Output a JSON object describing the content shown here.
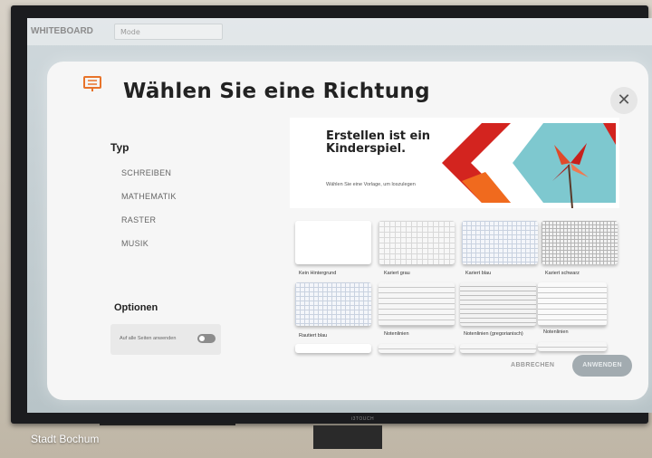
{
  "app": {
    "title": "WHITEBOARD",
    "field_text": "Mode"
  },
  "dialog": {
    "title": "Wählen Sie eine Richtung",
    "close_glyph": "✕",
    "type_heading": "Typ",
    "type_items": [
      "SCHREIBEN",
      "MATHEMATIK",
      "RASTER",
      "MUSIK"
    ],
    "options_heading": "Optionen",
    "apply_all_label": "Auf alle Seiten anwenden",
    "banner": {
      "headline": "Erstellen ist ein Kinderspiel.",
      "subtext": "Wählen Sie eine Vorlage, um loszulegen"
    },
    "templates": [
      {
        "label": "Kein Hintergrund"
      },
      {
        "label": "Kariert grau"
      },
      {
        "label": "Kariert blau"
      },
      {
        "label": "Kariert schwarz"
      },
      {
        "label": "Rautiert blau"
      },
      {
        "label": "Notenlinien"
      },
      {
        "label": "Notenlinien (gregorianisch)"
      },
      {
        "label": "Notenlinien"
      }
    ],
    "cancel_label": "ABBRECHEN",
    "apply_label": "ANWENDEN"
  },
  "device_brand": "i3TOUCH",
  "caption": "Stadt Bochum",
  "colors": {
    "banner_red": "#d3241f",
    "banner_orange": "#f06a1e",
    "banner_teal": "#7ec8cf",
    "icon_orange": "#e8732a"
  }
}
